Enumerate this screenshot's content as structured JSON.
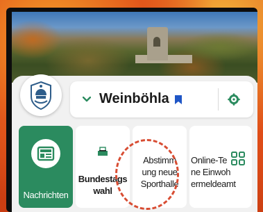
{
  "town": {
    "name": "Weinböhla"
  },
  "tiles": [
    {
      "label_line1": "Nachrichten",
      "label_line2": "",
      "label_line3": "",
      "icon": "newspaper-icon",
      "active": true
    },
    {
      "label_line1": "Bundestags",
      "label_line2": "wahl",
      "label_line3": "",
      "icon": "ballot-icon",
      "active": false
    },
    {
      "label_line1": "Abstimm",
      "label_line2": "ung neue",
      "label_line3": "Sporthalle",
      "icon": "",
      "active": false
    },
    {
      "label_line1": "Online-Te",
      "label_line2": "ne Einwoh",
      "label_line3": "ermeldeamt",
      "icon": "",
      "active": false
    }
  ],
  "colors": {
    "accent": "#2b8b5f",
    "bookmark": "#1f56c6",
    "highlight_circle": "#d84d33",
    "backdrop": "#e8651c"
  },
  "icons": {
    "chevron": "chevron-down-icon",
    "bookmark": "bookmark-icon",
    "settings": "gear-icon",
    "more": "grid-icon",
    "crest": "coat-of-arms-icon"
  }
}
